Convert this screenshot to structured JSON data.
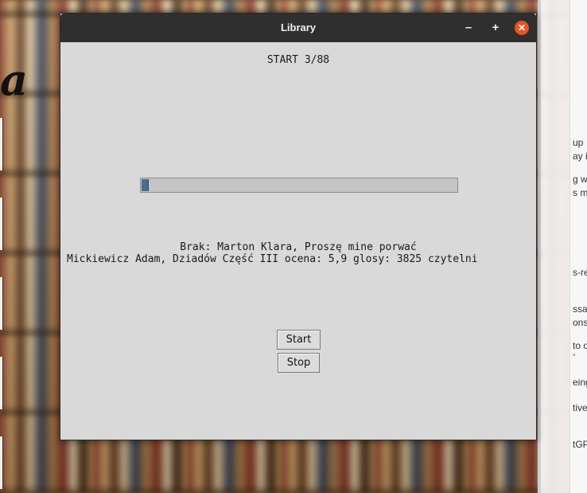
{
  "window": {
    "title": "Library",
    "minimize_glyph": "–",
    "maximize_glyph": "+",
    "close_glyph": "✕"
  },
  "status": {
    "header": "START 3/88",
    "progress_fraction": 0.02,
    "line1": "Brak: Marton Klara, Proszę mine porwać",
    "line2": "Mickiewicz Adam, Dziadów Część III ocena: 5,9 glosy: 3825 czytelni"
  },
  "buttons": {
    "start": "Start",
    "stop": "Stop"
  },
  "background": {
    "logo_fragment": "a",
    "snippets": [
      "up",
      "ay it",
      "g wo",
      "s m",
      "s-re",
      "ssar",
      "onse",
      "to o",
      "\"",
      "eing",
      "tive",
      "tGP"
    ]
  },
  "colors": {
    "titlebar": "#2f2f2f",
    "close_button": "#e95420",
    "window_bg": "#d9d9d9",
    "progress_fill": "#4a6c8e"
  }
}
